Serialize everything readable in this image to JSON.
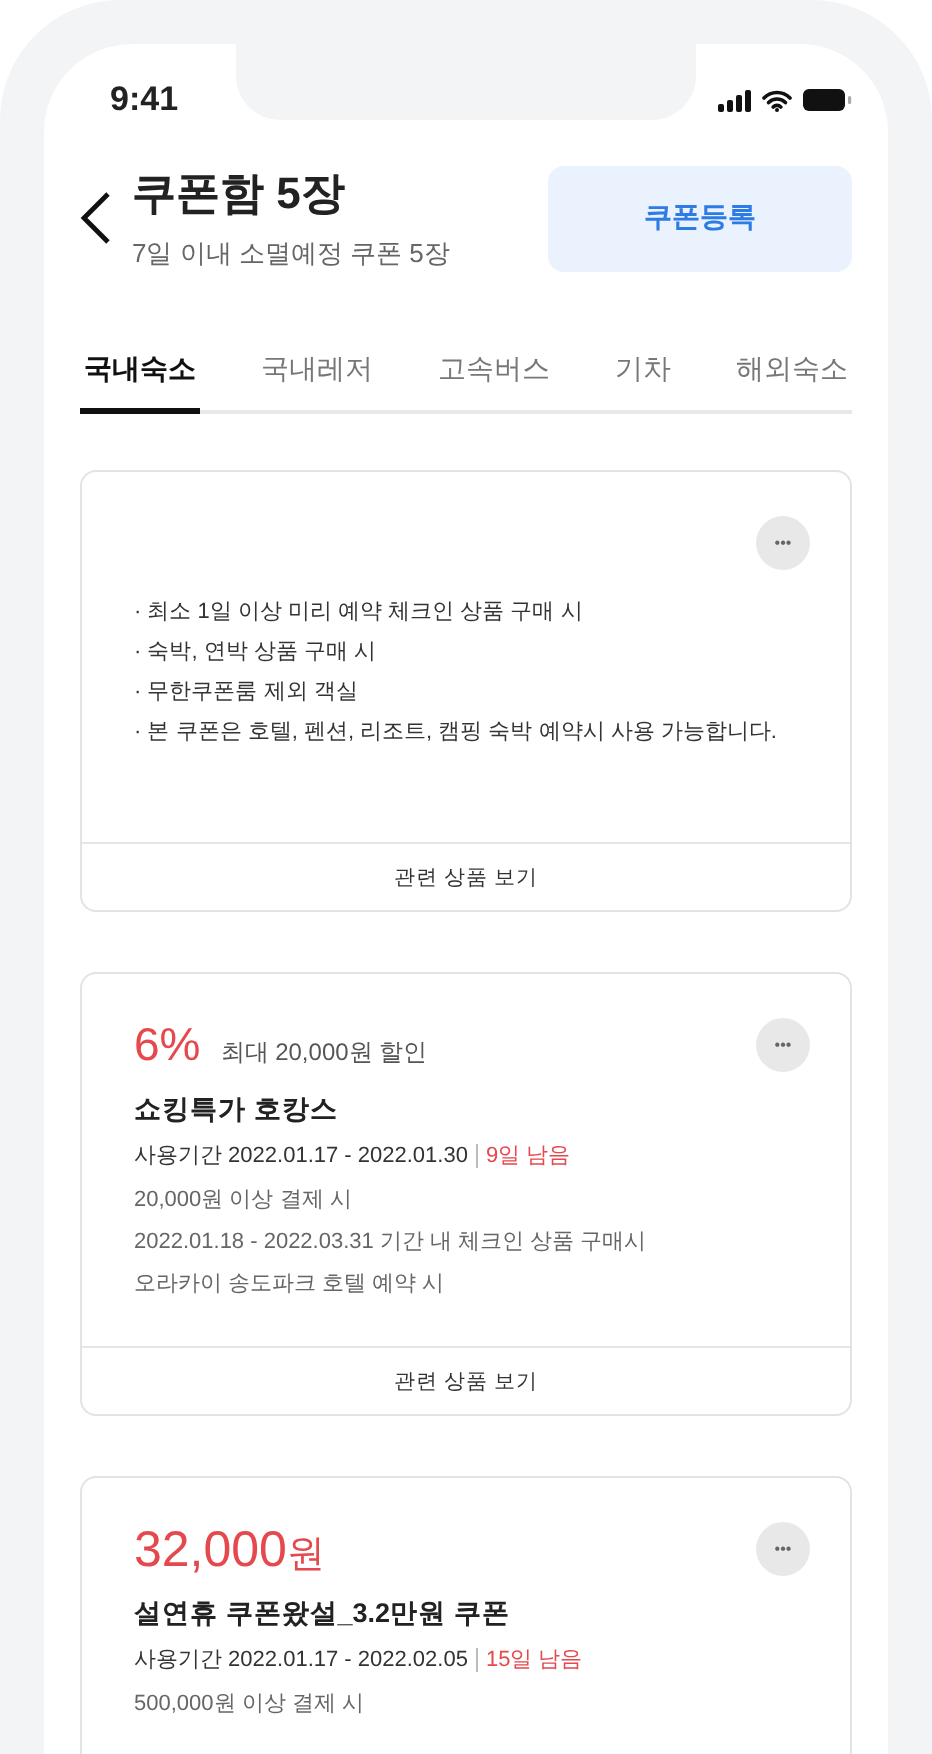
{
  "status_bar": {
    "time": "9:41"
  },
  "header": {
    "title": "쿠폰함 5장",
    "subtitle": "7일 이내 소멸예정 쿠폰 5장",
    "register_button": "쿠폰등록"
  },
  "tabs": [
    {
      "label": "국내숙소",
      "selected": true
    },
    {
      "label": "국내레저",
      "selected": false
    },
    {
      "label": "고속버스",
      "selected": false
    },
    {
      "label": "기차",
      "selected": false
    },
    {
      "label": "해외숙소",
      "selected": false
    }
  ],
  "coupons": [
    {
      "kind": "notice",
      "conditions": [
        "· 최소 1일 이상 미리 예약 체크인 상품 구매 시",
        "· 숙박, 연박 상품 구매 시",
        "· 무한쿠폰룸 제외 객실",
        "· 본 쿠폰은 호텔, 펜션, 리조트, 캠핑 숙박 예약시 사용 가능합니다."
      ],
      "more": "•••",
      "link": "관련 상품 보기"
    },
    {
      "kind": "percent",
      "amount": "6%",
      "max_discount": "최대 20,000원 할인",
      "name": "쇼킹특가 호캉스",
      "period": "사용기간 2022.01.17 - 2022.01.30",
      "remaining": "9일 남음",
      "conditions": [
        "20,000원 이상 결제 시",
        "2022.01.18 - 2022.03.31 기간 내 체크인 상품 구매시",
        "오라카이 송도파크 호텔 예약 시"
      ],
      "more": "•••",
      "link": "관련 상품 보기"
    },
    {
      "kind": "amount",
      "amount": "32,000",
      "unit": "원",
      "name": "설연휴 쿠폰왔설_3.2만원 쿠폰",
      "period": "사용기간 2022.01.17 - 2022.02.05",
      "remaining": "15일 남음",
      "conditions": [
        "500,000원 이상 결제 시"
      ],
      "more": "•••"
    }
  ]
}
